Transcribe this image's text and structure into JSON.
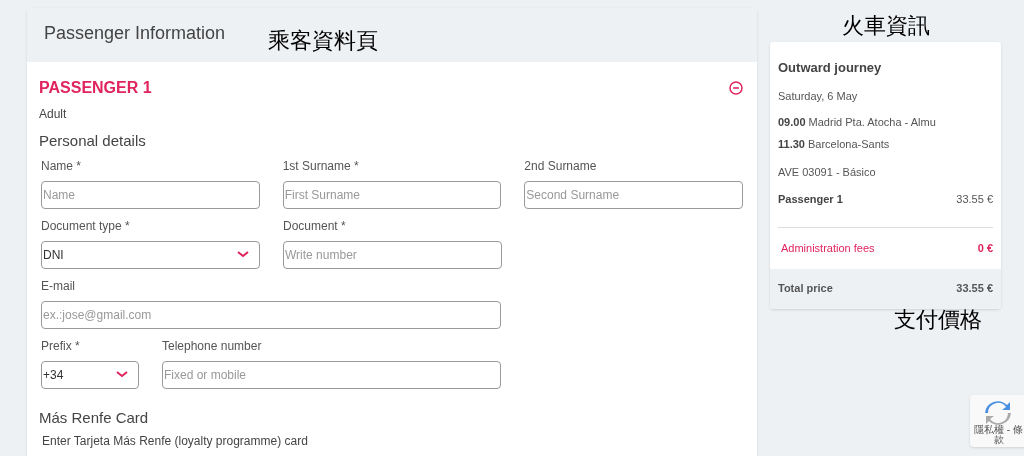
{
  "form": {
    "title": "Passenger Information",
    "passenger": {
      "heading": "PASSENGER 1",
      "type": "Adult",
      "expanded": true
    },
    "personal_details": {
      "heading": "Personal details",
      "rows": [
        [
          {
            "kind": "text",
            "label": "Name *",
            "placeholder": "Name"
          },
          {
            "kind": "text",
            "label": "1st Surname *",
            "placeholder": "First Surname"
          },
          {
            "kind": "text",
            "label": "2nd Surname",
            "placeholder": "Second Surname"
          }
        ],
        [
          {
            "kind": "select",
            "label": "Document type *",
            "value": "DNI"
          },
          {
            "kind": "text",
            "label": "Document *",
            "placeholder": "Write number"
          }
        ],
        [
          {
            "kind": "wide",
            "label": "E-mail",
            "placeholder": "ex.:jose@gmail.com"
          }
        ],
        [
          {
            "kind": "prefix",
            "label": "Prefix *",
            "value": "+34"
          },
          {
            "kind": "phone",
            "label": "Telephone number",
            "placeholder": "Fixed or mobile"
          }
        ]
      ]
    },
    "card": {
      "heading": "Más Renfe Card",
      "text": "Enter Tarjeta Más Renfe (loyalty programme) card"
    }
  },
  "summary": {
    "title": "Outward journey",
    "date": "Saturday, 6 May",
    "legs": [
      {
        "time": "09.00",
        "station": "Madrid Pta. Atocha - Almu"
      },
      {
        "time": "11.30",
        "station": "Barcelona-Sants"
      }
    ],
    "train": "AVE 03091 - Básico",
    "passenger": {
      "label": "Passenger 1",
      "price": "33.55 €"
    },
    "fees": {
      "label": "Administration fees",
      "price": "0 €"
    },
    "total": {
      "label": "Total price",
      "price": "33.55 €"
    }
  },
  "annotations": [
    "乘客資料頁",
    "火車資訊",
    "支付價格"
  ],
  "recaptcha": {
    "text": [
      "隱私權 - 條",
      "款"
    ]
  }
}
